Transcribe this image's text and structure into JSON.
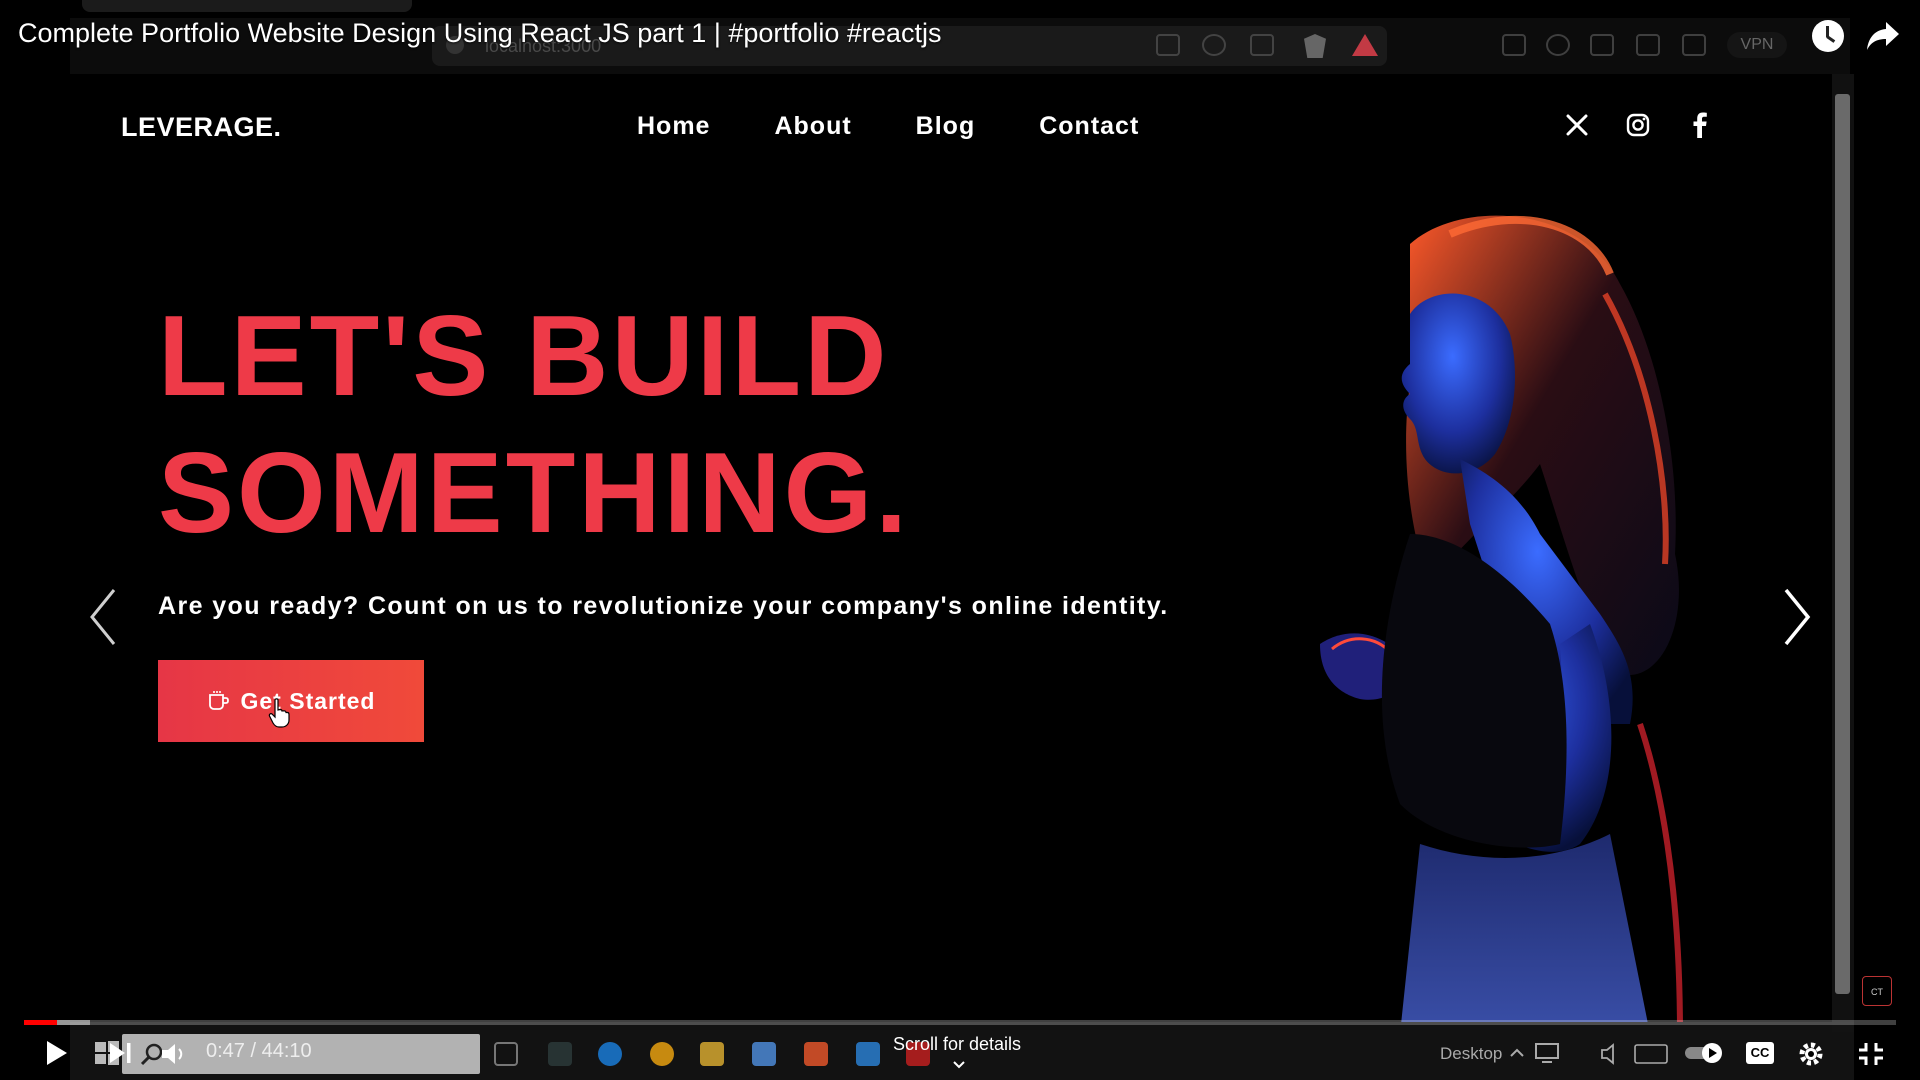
{
  "video": {
    "title": "Complete Portfolio Website Design Using React JS part 1 | #portfolio #reactjs",
    "current_time": "0:47",
    "duration": "44:10",
    "time_display": "0:47 / 44:10",
    "played_fraction": 0.0177,
    "buffered_fraction": 0.035,
    "scroll_hint": "Scroll for details",
    "badge": "CT"
  },
  "browser": {
    "url": "localhost:3000",
    "vpn_label": "VPN"
  },
  "site": {
    "logo": "LEVERAGE.",
    "nav": [
      {
        "label": "Home"
      },
      {
        "label": "About"
      },
      {
        "label": "Blog"
      },
      {
        "label": "Contact"
      }
    ],
    "social": [
      "x-icon",
      "instagram-icon",
      "facebook-icon"
    ],
    "hero": {
      "line1": "LET'S BUILD",
      "line2": "SOMETHING.",
      "subtitle": "Are you ready? Count on us to revolutionize your company's online identity.",
      "cta_label": "Get Started"
    }
  },
  "taskbar": {
    "search_placeholder": "Search",
    "desktop_label": "Desktop"
  },
  "colors": {
    "accent": "#ee3a48",
    "cta_gradient_end": "#f04a3a",
    "progress": "#ff0000"
  }
}
